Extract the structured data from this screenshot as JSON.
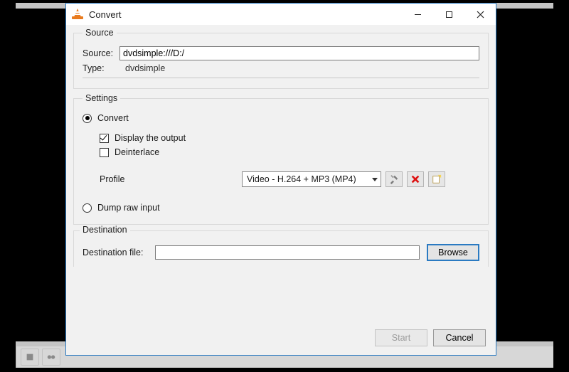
{
  "window": {
    "title": "Convert"
  },
  "source": {
    "legend": "Source",
    "source_label": "Source:",
    "source_value": "dvdsimple:///D:/",
    "type_label": "Type:",
    "type_value": "dvdsimple"
  },
  "settings": {
    "legend": "Settings",
    "convert_label": "Convert",
    "convert_selected": true,
    "display_output_label": "Display the output",
    "display_output_checked": true,
    "deinterlace_label": "Deinterlace",
    "deinterlace_checked": false,
    "profile_label": "Profile",
    "profile_selected": "Video - H.264 + MP3 (MP4)",
    "dump_label": "Dump raw input",
    "dump_selected": false,
    "icons": {
      "edit": "wrench-screwdriver-icon",
      "delete": "delete-icon",
      "new": "new-profile-icon"
    }
  },
  "destination": {
    "legend": "Destination",
    "file_label": "Destination file:",
    "file_value": "",
    "browse_label": "Browse"
  },
  "footer": {
    "start_label": "Start",
    "start_enabled": false,
    "cancel_label": "Cancel"
  }
}
